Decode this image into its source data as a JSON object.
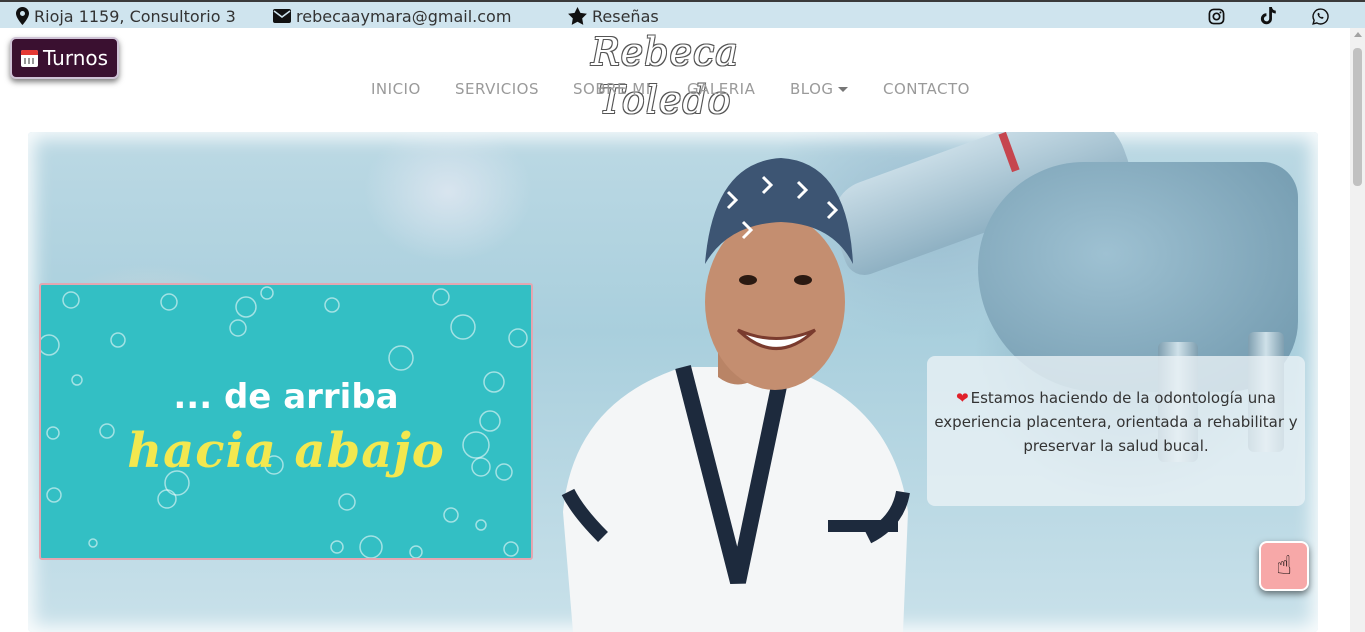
{
  "topbar": {
    "address": "Rioja 1159, Consultorio 3",
    "email": "rebecaaymara@gmail.com",
    "reviews": "Reseñas",
    "social": [
      "instagram-icon",
      "tiktok-icon",
      "whatsapp-icon"
    ]
  },
  "turnos_button": {
    "label": "Turnos"
  },
  "logo": {
    "text": "Rebeca Toledo"
  },
  "nav": {
    "items": [
      {
        "label": "INICIO"
      },
      {
        "label": "SERVICIOS"
      },
      {
        "label": "SOBRE MI"
      },
      {
        "label": "GALERIA"
      },
      {
        "label": "BLOG"
      },
      {
        "label": "CONTACTO"
      }
    ]
  },
  "promo": {
    "line1": "... de arriba",
    "line2": "hacia abajo"
  },
  "quote": {
    "text": "Estamos haciendo de la odontología una experiencia placentera, orientada a rehabilitar y preservar la salud bucal."
  },
  "fab": {
    "icon": "pointing-hand-icon",
    "glyph": "☝"
  },
  "colors": {
    "topbar_bg": "#cfe4ee",
    "turnos_bg": "#3a1030",
    "promo_bg": "#33bfc4",
    "promo_text2": "#f3e84f",
    "fab_bg": "#f7a8a8"
  }
}
